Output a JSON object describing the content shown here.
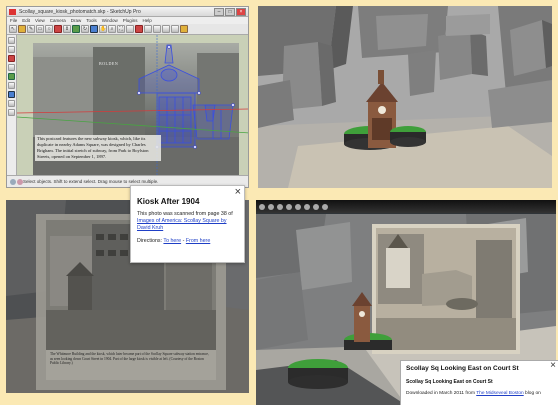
{
  "sketchup": {
    "title": "Scollay_square_kiosk_photomatch.skp - SketchUp Pro",
    "menu": [
      "File",
      "Edit",
      "View",
      "Camera",
      "Draw",
      "Tools",
      "Window",
      "Plugins",
      "Help"
    ],
    "photo_caption": "This postcard features the new subway kiosk, which, like its duplicate in nearby Adams Square, was designed by Charles Brigham. The initial stretch of subway, from Park to Boylston Streets, opened on September 1, 1897.",
    "status_text": "Select objects. Shift to extend select. Drag mouse to select multiple.",
    "controls": {
      "minimize": "–",
      "maximize": "□",
      "close": "×"
    }
  },
  "popup_kiosk": {
    "title": "Kiosk After 1904",
    "text_prefix": "This photo was scanned from page 38 of",
    "link_text": "Images of America: Scollay Square by David Kruh",
    "directions_label": "Directions:",
    "to_here": "To here",
    "separator": "-",
    "from_here": "From here",
    "close_label": "×"
  },
  "popup_scollay": {
    "title": "Scollay Sq Looking East on Court St",
    "subtitle": "Scollay Sq Looking East on Court St",
    "footer_prefix": "Downloaded in March 2011 from",
    "footer_link": "The Midseveal Boston",
    "footer_suffix": "blog on",
    "close_label": "×"
  },
  "panel3_caption": "The Whitmore Building and the kiosk, which later became part of the Scollay Square subway station entrance, as seen looking down Court Street in 1904. Part of the large kiosk is visible at left. (Courtesy of the Boston Public Library.)",
  "colors": {
    "background": "#fbe9b4",
    "link": "#1f3fc6",
    "wireframe": "#3a4fe0",
    "roof_green": "#3f9f3a",
    "sketchup_green_axis": "#48a442",
    "sketchup_red_axis": "#d43b3b"
  },
  "icons": [
    "select-tool-icon",
    "eraser-icon",
    "pencil-icon",
    "rectangle-icon",
    "circle-icon",
    "paint-bucket-icon",
    "push-pull-icon",
    "move-icon",
    "rotate-icon",
    "orbit-icon",
    "pan-icon",
    "zoom-icon",
    "zoom-extents-icon",
    "close-icon",
    "info-icon"
  ]
}
